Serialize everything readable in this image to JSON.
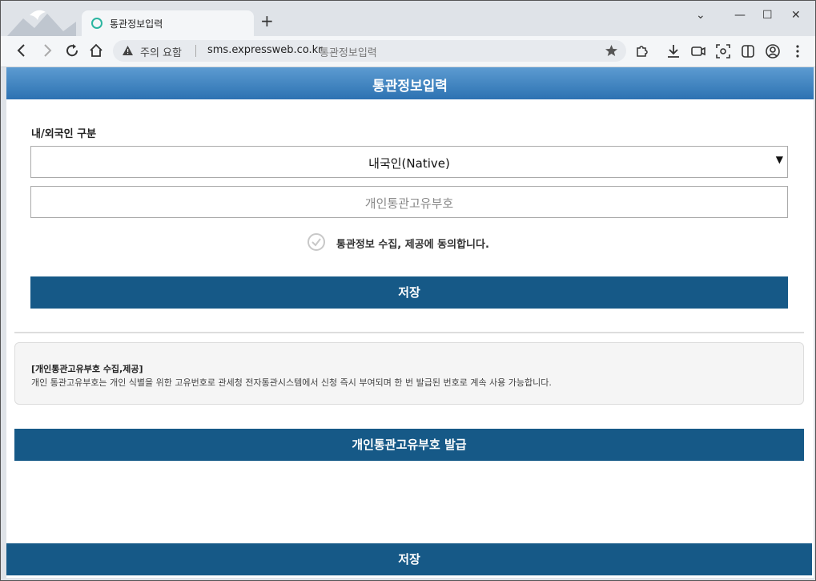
{
  "browser": {
    "tab_title": "통관정보입력",
    "new_tab": "+",
    "security_warning": "주의 요함",
    "url_host": "sms.expressweb.co.kr",
    "url_title": "통관정보입력"
  },
  "page": {
    "header_title": "통관정보입력",
    "foreigner_label": "내/외국인 구분",
    "foreigner_select_value": "내국인(Native)",
    "customs_id_placeholder": "개인통관고유부호",
    "consent_label": "통관정보 수집, 제공에 동의합니다.",
    "save_label": "저장",
    "info_title": "[개인통관고유부호 수집,제공]",
    "info_text": "개인 통관고유부호는 개인 식별을 위한 고유번호로 관세청 전자통관시스템에서 신청 즉시 부여되며 한 번 발급된 번호로 계속 사용 가능합니다.",
    "issue_label": "개인통관고유부호 발급",
    "bottom_save_label": "저장"
  },
  "colors": {
    "button_bg": "#165987",
    "header_gradient_top": "#5c9bd1",
    "header_gradient_bottom": "#2d72b2",
    "favicon": "#2bb5a0"
  }
}
